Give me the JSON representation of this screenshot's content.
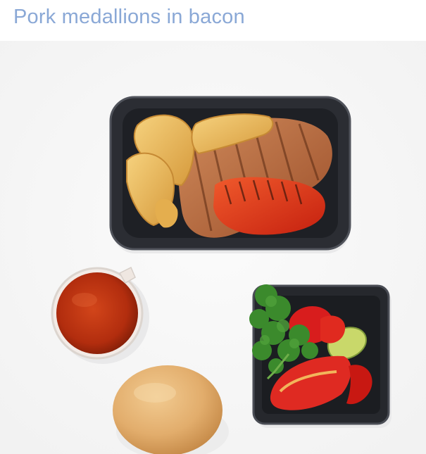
{
  "header": {
    "title": "Pork medallions in bacon"
  },
  "photo": {
    "items": [
      "main-tray-icon",
      "sauce-cup-icon",
      "bread-roll-icon",
      "salad-tray-icon"
    ],
    "colors": {
      "tray": "#2b2d33",
      "tray_rim": "#4a4d55",
      "potato": "#e9b55a",
      "pork": "#b86a3e",
      "pepper": "#e0331c",
      "sauce": "#b8300f",
      "bun": "#e4b274",
      "tomato": "#d81d1d",
      "parsley": "#3b8a2c",
      "cucumber": "#c9d86a"
    }
  }
}
